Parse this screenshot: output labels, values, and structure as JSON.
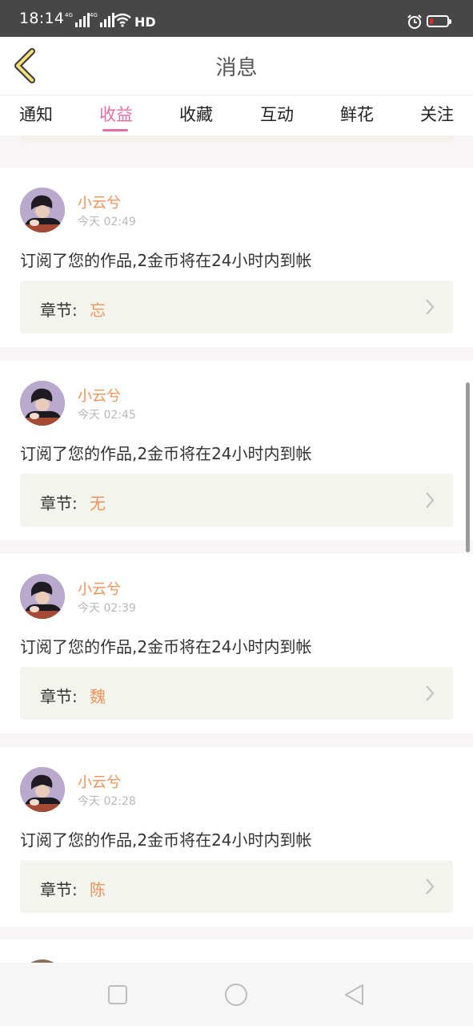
{
  "status_bar": {
    "time": "18:14",
    "network_1": "4G",
    "network_2": "4G",
    "hd_label": "HD",
    "icons": [
      "signal-icon",
      "signal-icon",
      "wifi-icon",
      "alarm-icon",
      "battery-icon"
    ],
    "battery_color": "#e02a2a"
  },
  "header": {
    "title": "消息",
    "back_icon": "chevron-left-icon",
    "back_icon_color": "#f3e07a"
  },
  "tabs": [
    {
      "label": "通知"
    },
    {
      "label": "收益"
    },
    {
      "label": "收藏"
    },
    {
      "label": "互动"
    },
    {
      "label": "鲜花"
    },
    {
      "label": "关注"
    }
  ],
  "active_tab": "收益",
  "colors": {
    "accent_pink": "#e36ea6",
    "username_orange": "#f0935b",
    "chapter_bg": "#f4f4ee"
  },
  "messages": [
    {
      "user": "小云兮",
      "time": "今天 02:49",
      "text": "订阅了您的作品,2金币将在24小时内到帐",
      "chapter_label": "章节:",
      "chapter": "忘"
    },
    {
      "user": "小云兮",
      "time": "今天 02:45",
      "text": "订阅了您的作品,2金币将在24小时内到帐",
      "chapter_label": "章节:",
      "chapter": "无"
    },
    {
      "user": "小云兮",
      "time": "今天 02:39",
      "text": "订阅了您的作品,2金币将在24小时内到帐",
      "chapter_label": "章节:",
      "chapter": "魏"
    },
    {
      "user": "小云兮",
      "time": "今天 02:28",
      "text": "订阅了您的作品,2金币将在24小时内到帐",
      "chapter_label": "章节:",
      "chapter": "陈"
    }
  ],
  "nav_bar": {
    "icons": [
      "recent-apps-icon",
      "home-icon",
      "back-icon"
    ]
  }
}
